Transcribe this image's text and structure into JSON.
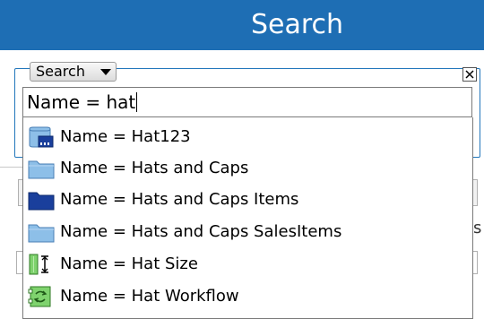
{
  "header": {
    "title": "Search"
  },
  "search": {
    "mode_label": "Search",
    "query": "Name = hat"
  },
  "results": [
    {
      "label": "Name = Hat123",
      "icon": "list-table-icon"
    },
    {
      "label": "Name = Hats and Caps",
      "icon": "folder-light-icon"
    },
    {
      "label": "Name = Hats and Caps Items",
      "icon": "folder-dark-icon"
    },
    {
      "label": "Name = Hats and Caps SalesItems",
      "icon": "folder-light-icon"
    },
    {
      "label": "Name = Hat Size",
      "icon": "field-size-icon"
    },
    {
      "label": "Name = Hat Workflow",
      "icon": "workflow-icon"
    }
  ],
  "background": {
    "partial_text": "s"
  },
  "colors": {
    "header_bg": "#1e6eb4",
    "group_border": "#2277bb",
    "folder_light": "#8dbfe8",
    "folder_dark": "#1a3f9c",
    "workflow_green": "#37a02e"
  }
}
